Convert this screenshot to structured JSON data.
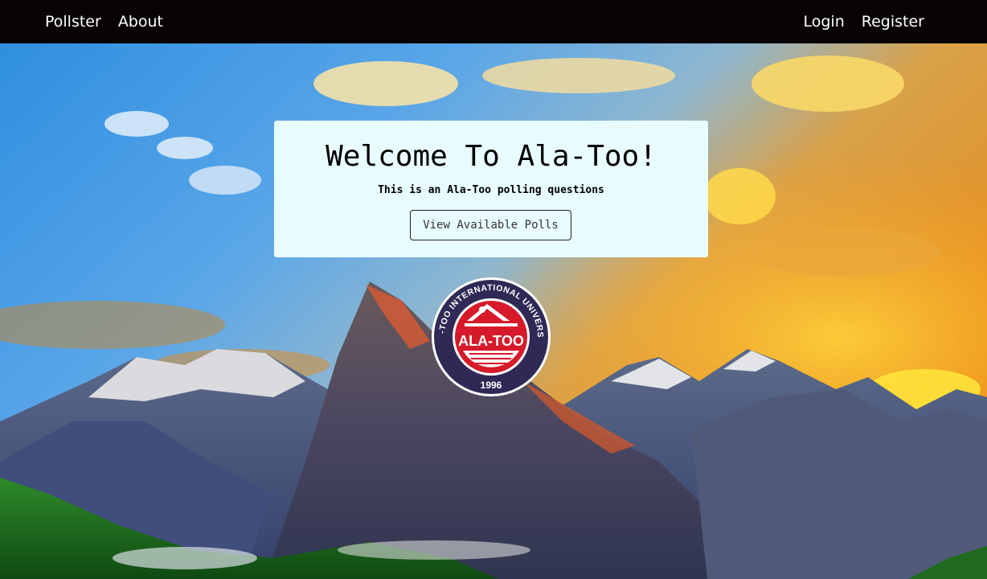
{
  "nav": {
    "brand": "Pollster",
    "about": "About",
    "login": "Login",
    "register": "Register"
  },
  "welcome": {
    "title": "Welcome To Ala-Too!",
    "subtitle": "This is an Ala-Too polling questions",
    "button_label": "View Available Polls"
  },
  "logo": {
    "ring_text": "ALA-TOO INTERNATIONAL UNIVERSITY",
    "name": "ALA-TOO",
    "year": "1996",
    "ring_color": "#2e2a55",
    "center_color": "#d71a2a"
  },
  "colors": {
    "navbar_bg": "#070203",
    "card_bg": "#e8fbff"
  }
}
